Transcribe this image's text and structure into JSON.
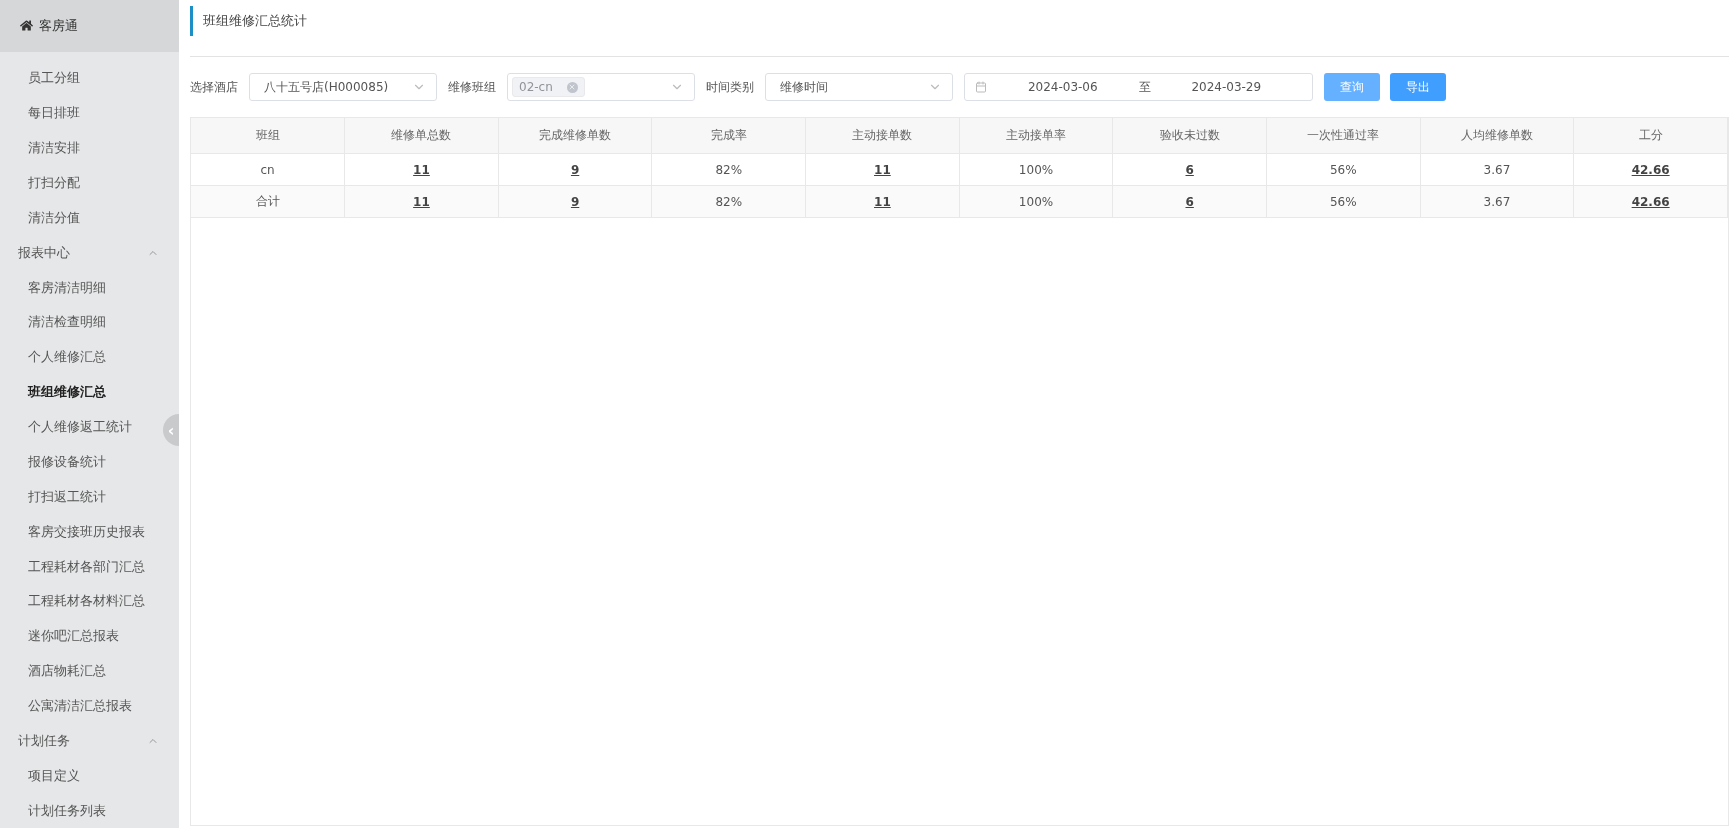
{
  "sidebar": {
    "header": "客房通",
    "collapse_handle": "‹",
    "items": [
      {
        "kind": "link",
        "label": "员工分组",
        "selected": false
      },
      {
        "kind": "link",
        "label": "每日排班",
        "selected": false
      },
      {
        "kind": "link",
        "label": "清洁安排",
        "selected": false
      },
      {
        "kind": "link",
        "label": "打扫分配",
        "selected": false
      },
      {
        "kind": "link",
        "label": "清洁分值",
        "selected": false
      },
      {
        "kind": "group",
        "label": "报表中心",
        "expanded": true,
        "children": [
          {
            "label": "客房清洁明细",
            "selected": false
          },
          {
            "label": "清洁检查明细",
            "selected": false
          },
          {
            "label": "个人维修汇总",
            "selected": false
          },
          {
            "label": "班组维修汇总",
            "selected": true
          },
          {
            "label": "个人维修返工统计",
            "selected": false
          },
          {
            "label": "报修设备统计",
            "selected": false
          },
          {
            "label": "打扫返工统计",
            "selected": false
          },
          {
            "label": "客房交接班历史报表",
            "selected": false
          },
          {
            "label": "工程耗材各部门汇总",
            "selected": false
          },
          {
            "label": "工程耗材各材料汇总",
            "selected": false
          },
          {
            "label": "迷你吧汇总报表",
            "selected": false
          },
          {
            "label": "酒店物耗汇总",
            "selected": false
          },
          {
            "label": "公寓清洁汇总报表",
            "selected": false
          }
        ]
      },
      {
        "kind": "group",
        "label": "计划任务",
        "expanded": true,
        "children": [
          {
            "label": "项目定义",
            "selected": false
          },
          {
            "label": "计划任务列表",
            "selected": false
          }
        ]
      }
    ]
  },
  "page_title": "班组维修汇总统计",
  "filters": [
    {
      "kind": "select",
      "label": "选择酒店",
      "value": "八十五号店(H000085)"
    },
    {
      "kind": "tags",
      "label": "维修班组",
      "tags": [
        "02-cn"
      ]
    },
    {
      "kind": "select",
      "label": "时间类别",
      "value": "维修时间"
    },
    {
      "kind": "daterange",
      "start": "2024-03-06",
      "separator": "至",
      "end": "2024-03-29"
    }
  ],
  "buttons": [
    {
      "label": "查询",
      "focused": true
    },
    {
      "label": "导出",
      "focused": false
    }
  ],
  "table": {
    "columns": [
      "班组",
      "维修单总数",
      "完成维修单数",
      "完成率",
      "主动接单数",
      "主动接单率",
      "验收未过数",
      "一次性通过率",
      "人均维修单数",
      "工分"
    ],
    "rows": [
      [
        {
          "text": "cn",
          "link": false
        },
        {
          "text": "11",
          "link": true
        },
        {
          "text": "9",
          "link": true
        },
        {
          "text": "82%",
          "link": false
        },
        {
          "text": "11",
          "link": true
        },
        {
          "text": "100%",
          "link": false
        },
        {
          "text": "6",
          "link": true
        },
        {
          "text": "56%",
          "link": false
        },
        {
          "text": "3.67",
          "link": false
        },
        {
          "text": "42.66",
          "link": true
        }
      ],
      [
        {
          "text": "合计",
          "link": false
        },
        {
          "text": "11",
          "link": true
        },
        {
          "text": "9",
          "link": true
        },
        {
          "text": "82%",
          "link": false
        },
        {
          "text": "11",
          "link": true
        },
        {
          "text": "100%",
          "link": false
        },
        {
          "text": "6",
          "link": true
        },
        {
          "text": "56%",
          "link": false
        },
        {
          "text": "3.67",
          "link": false
        },
        {
          "text": "42.66",
          "link": true
        }
      ]
    ]
  }
}
